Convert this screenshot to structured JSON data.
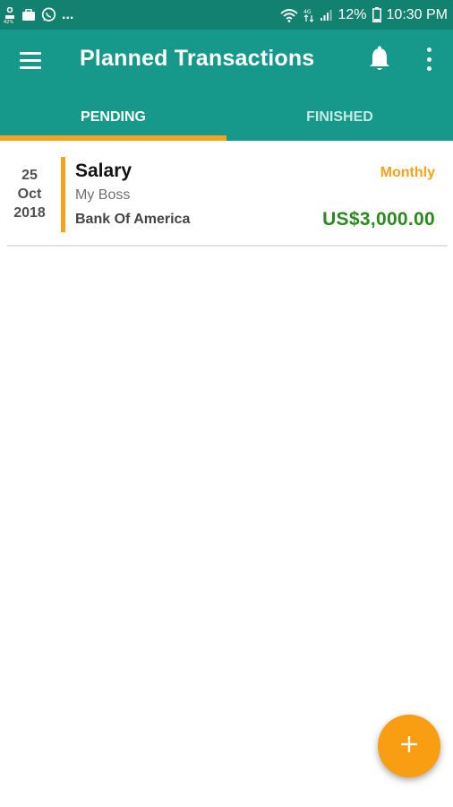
{
  "status_bar": {
    "battery": "12%",
    "time": "10:30 PM",
    "left_overflow": "...",
    "left_icons": [
      "usb-icon",
      "case-icon",
      "whatsapp-icon"
    ],
    "right_icons": [
      "wifi-icon",
      "data-icon",
      "signal-icon",
      "battery-icon"
    ]
  },
  "app_bar": {
    "title": "Planned Transactions",
    "icons": [
      "menu-icon",
      "bell-icon",
      "more-vert-icon"
    ]
  },
  "tabs": [
    {
      "label": "PENDING",
      "active": true
    },
    {
      "label": "FINISHED",
      "active": false
    }
  ],
  "transactions": [
    {
      "date_day": "25",
      "date_month": "Oct",
      "date_year": "2018",
      "title": "Salary",
      "payee": "My Boss",
      "account": "Bank Of America",
      "frequency": "Monthly",
      "amount": "US$3,000.00"
    }
  ],
  "fab": {
    "icon": "plus-icon"
  },
  "colors": {
    "primary": "#16998a",
    "primary_dark": "#13816f",
    "accent": "#f7a21b",
    "amount_positive": "#2a8a1e"
  }
}
